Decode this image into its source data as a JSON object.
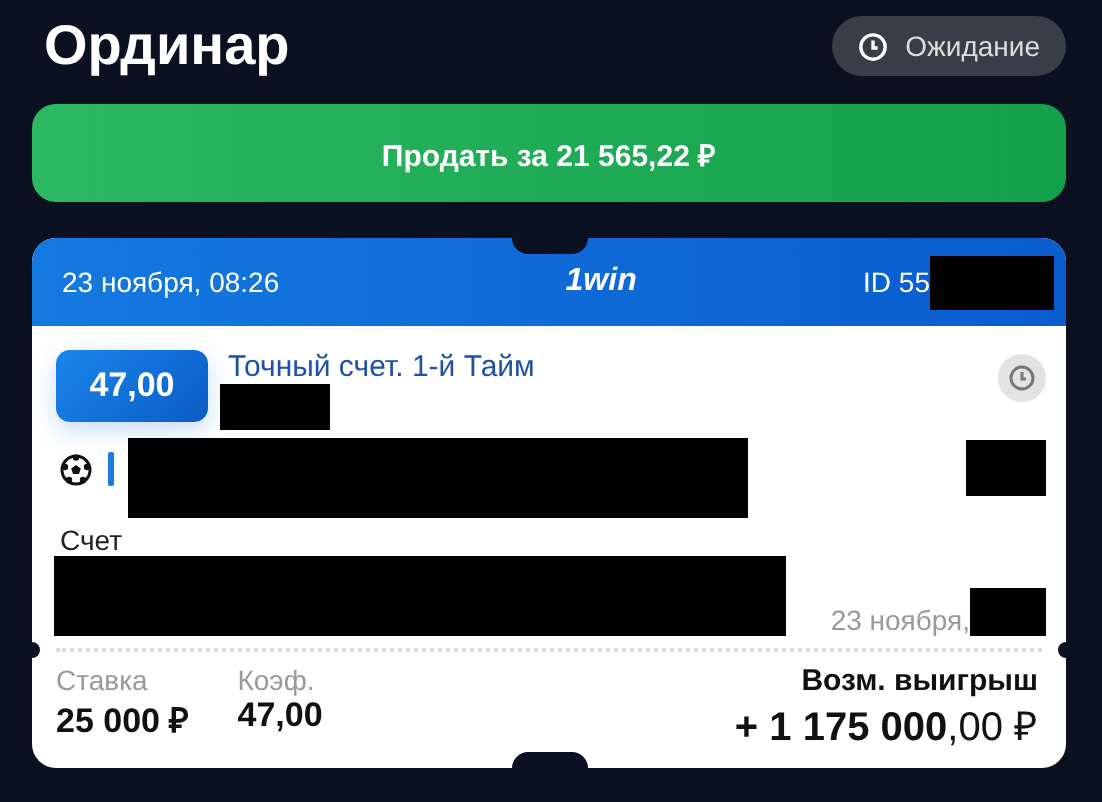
{
  "title": "Ординар",
  "status": {
    "label": "Ожидание"
  },
  "sell_button": {
    "label": "Продать за 21 565,22 ₽"
  },
  "ticket": {
    "date": "23 ноября, 08:26",
    "logo": "1win",
    "id": "ID 55",
    "odds": "47,00",
    "market": "Точный счет. 1-й Тайм",
    "outcome_label": "Счет",
    "event_date": "23 ноября,",
    "stake_label": "Ставка",
    "stake": "25 000 ₽",
    "coef_label": "Коэф.",
    "coef": "47,00",
    "win_label": "Возм. выигрыш",
    "win": "**+ 1 175 000**,00 ₽"
  }
}
